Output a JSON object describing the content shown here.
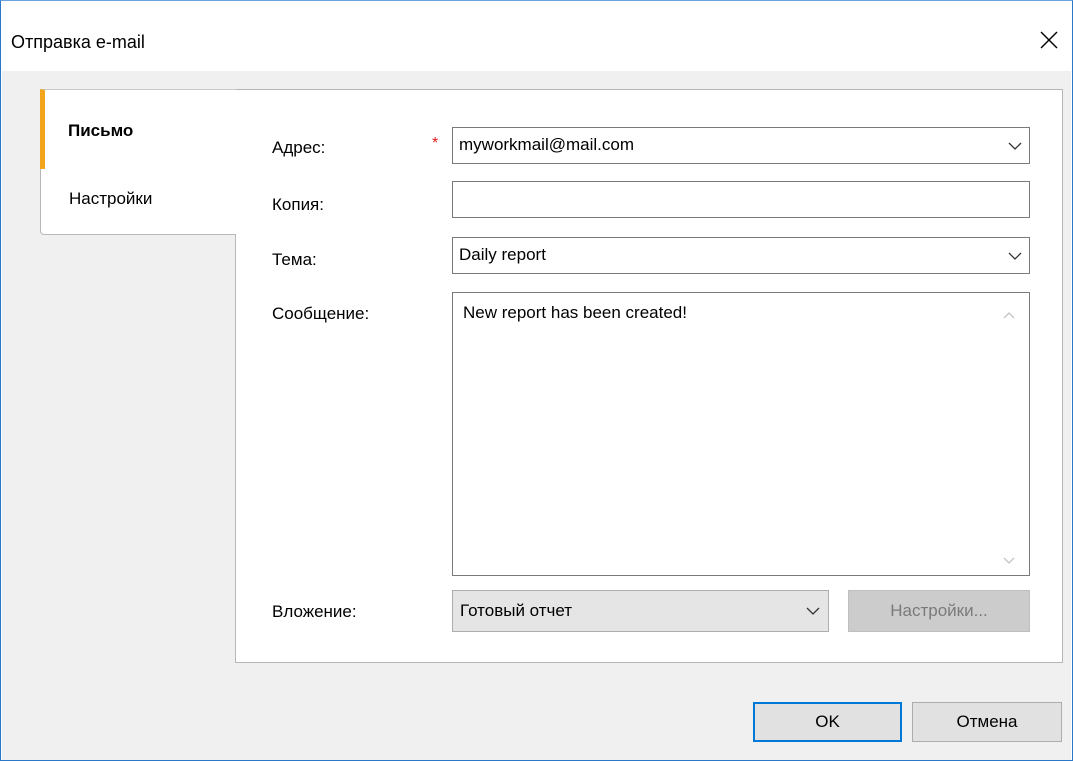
{
  "window": {
    "title": "Отправка e-mail",
    "close_icon": "close-icon"
  },
  "tabs": [
    {
      "label": "Письмо",
      "active": true
    },
    {
      "label": "Настройки",
      "active": false
    }
  ],
  "form": {
    "address": {
      "label": "Адрес:",
      "value": "myworkmail@mail.com",
      "required_mark": "*"
    },
    "copy": {
      "label": "Копия:",
      "value": ""
    },
    "subject": {
      "label": "Тема:",
      "value": "Daily report"
    },
    "message": {
      "label": "Сообщение:",
      "value": "New report has been created!"
    },
    "attachment": {
      "label": "Вложение:",
      "value": "Готовый отчет",
      "settings_label": "Настройки..."
    }
  },
  "footer": {
    "ok_label": "OK",
    "cancel_label": "Отмена"
  },
  "colors": {
    "accent_tab": "#f2a51a",
    "focus_border": "#0078d7",
    "required": "#e02020",
    "window_border": "#2b78c8"
  }
}
